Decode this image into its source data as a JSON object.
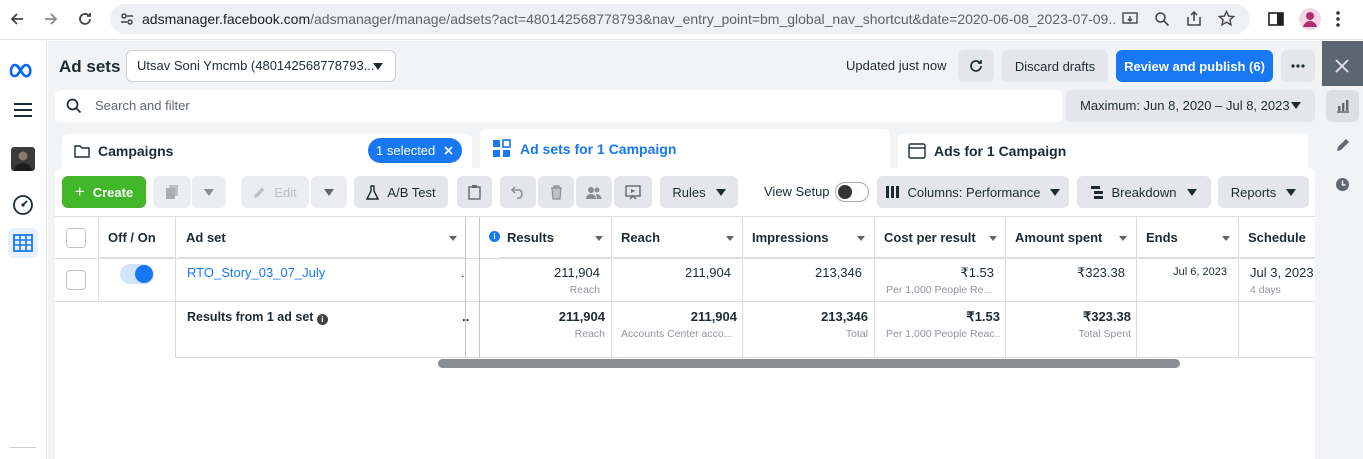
{
  "browser": {
    "url": "adsmanager.facebook.com",
    "url_path": "/adsmanager/manage/adsets?act=480142568778793&nav_entry_point=bm_global_nav_shortcut&date=2020-06-08_2023-07-09..."
  },
  "header": {
    "title": "Ad sets",
    "account": "Utsav Soni Ymcmb (480142568778793...",
    "status": "Updated just now",
    "discard_label": "Discard drafts",
    "review_label": "Review and publish (6)"
  },
  "search": {
    "placeholder": "Search and filter",
    "date_range": "Maximum: Jun 8, 2020 – Jul 8, 2023"
  },
  "tabs": {
    "campaigns": "Campaigns",
    "selected_pill": "1 selected",
    "adsets": "Ad sets for 1 Campaign",
    "ads": "Ads for 1 Campaign"
  },
  "toolbar": {
    "create": "Create",
    "edit": "Edit",
    "ab_test": "A/B Test",
    "rules": "Rules",
    "view_setup": "View Setup",
    "columns": "Columns: Performance",
    "breakdown": "Breakdown",
    "reports": "Reports"
  },
  "table": {
    "headers": {
      "off_on": "Off / On",
      "ad_set": "Ad set",
      "results": "Results",
      "reach": "Reach",
      "impressions": "Impressions",
      "cost_per_result": "Cost per result",
      "amount_spent": "Amount spent",
      "ends": "Ends",
      "schedule": "Schedule"
    },
    "row": {
      "name": "RTO_Story_03_07_July",
      "results": "211,904",
      "results_sub": "Reach",
      "reach": "211,904",
      "impressions": "213,346",
      "cost": "₹1.53",
      "cost_sub": "Per 1,000 People Re...",
      "spent": "₹323.38",
      "ends": "Jul 6, 2023",
      "schedule": "Jul 3, 2023",
      "schedule_sub": "4 days"
    },
    "summary": {
      "label": "Results from 1 ad set",
      "results": "211,904",
      "results_sub": "Reach",
      "reach": "211,904",
      "reach_sub": "Accounts Center acco...",
      "impressions": "213,346",
      "impressions_sub": "Total",
      "cost": "₹1.53",
      "cost_sub": "Per 1,000 People Reac...",
      "spent": "₹323.38",
      "spent_sub": "Total Spent"
    }
  },
  "colors": {
    "primary": "#1877f2",
    "create_green": "#42b72a",
    "side_panel": "#5c6670"
  }
}
